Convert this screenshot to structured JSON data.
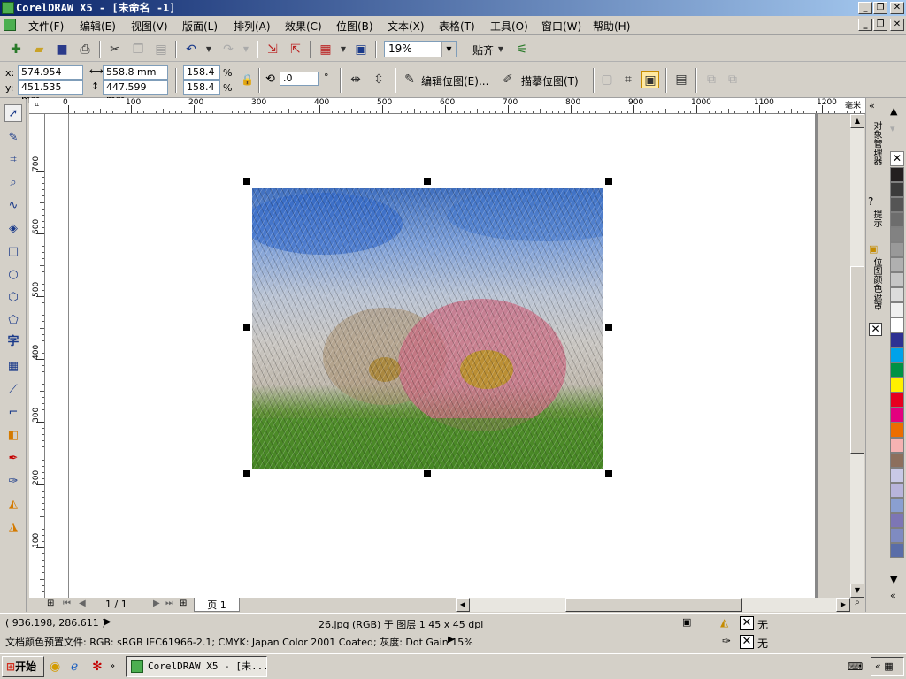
{
  "window": {
    "title": "CorelDRAW X5 - [未命名 -1]",
    "controls": [
      "_",
      "❐",
      "✕"
    ]
  },
  "menu": {
    "items": [
      "文件(F)",
      "编辑(E)",
      "视图(V)",
      "版面(L)",
      "排列(A)",
      "效果(C)",
      "位图(B)",
      "文本(X)",
      "表格(T)",
      "工具(O)",
      "窗口(W)",
      "帮助(H)"
    ]
  },
  "toolbar": {
    "zoom_value": "19%",
    "snap_label": "贴齐"
  },
  "property_bar": {
    "x_label": "x:",
    "x_value": "574.954 mm",
    "y_label": "y:",
    "y_value": "451.535 mm",
    "width_value": "558.8 mm",
    "height_value": "447.599 mm",
    "scale_w": "158.4",
    "scale_h": "158.4",
    "percent": "%",
    "rotation_value": ".0",
    "degree": "°",
    "edit_bitmap_label": "编辑位图(E)...",
    "trace_bitmap_label": "描摹位图(T)"
  },
  "rulers": {
    "unit": "毫米",
    "h_ticks": [
      "0",
      "100",
      "200",
      "300",
      "400",
      "500",
      "600",
      "700",
      "800",
      "900",
      "1000",
      "1100",
      "1200"
    ],
    "v_ticks": [
      "700",
      "600",
      "500",
      "400",
      "300",
      "200",
      "100"
    ]
  },
  "docker": {
    "tab1": "对象管理器",
    "tab2": "提示",
    "tab3": "位图颜色遮罩"
  },
  "page_nav": {
    "page_count": "1 / 1",
    "tab_label": "页 1"
  },
  "status": {
    "coords": "( 936.198, 286.611 )",
    "object_info": "26.jpg (RGB) 于 图层 1 45 x 45 dpi",
    "fill_none": "无",
    "outline_none": "无",
    "color_profile": "文档颜色预置文件: RGB: sRGB IEC61966-2.1; CMYK: Japan Color 2001 Coated; 灰度: Dot Gain 15%"
  },
  "taskbar": {
    "start_label": "开始",
    "task_label": "CorelDRAW X5 - [未..."
  },
  "palette_colors": [
    "#231f20",
    "#3b3b3b",
    "#555555",
    "#6d6d6d",
    "#828282",
    "#999999",
    "#b0b0b0",
    "#c6c6c6",
    "#dcdcdc",
    "#f0f0f0",
    "#ffffff",
    "#2e3192",
    "#00a2e9",
    "#009245",
    "#fff100",
    "#e6001f",
    "#e4007f",
    "#ec6d00",
    "#f5b2b2",
    "#8c6f5d",
    "#c9c9e6",
    "#b8b4db",
    "#8a9fd1",
    "#7d76b5",
    "#7f8bc1",
    "#5a6da8"
  ]
}
